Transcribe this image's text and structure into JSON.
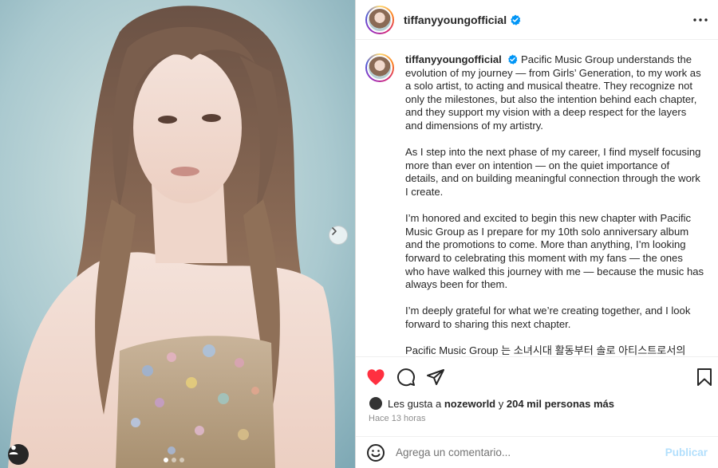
{
  "post": {
    "username": "tiffanyyoungofficial",
    "verified_icon": "verified-badge-icon",
    "accent_color": "#0095f6",
    "caption": {
      "paragraphs": [
        "Pacific Music Group understands the evolution of my journey — from Girls’ Generation, to my work as a solo artist, to acting and musical theatre. They recognize not only the milestones, but also the intention behind each chapter, and they support my vision with a deep respect for the layers and dimensions of my artistry.",
        "As I step into the next phase of my career, I find myself focusing more than ever on intention — on the quiet importance of details, and on building meaningful connection through the work I create.",
        "I’m honored and excited to begin this new chapter with Pacific Music Group as I prepare for my 10th solo anniversary album and the promotions to come. More than anything, I’m looking forward to celebrating this moment with my fans — the ones who have walked this journey with me — because the music has always been for them.",
        "I’m deeply grateful for what we’re creating together, and I look forward to sharing this next chapter.",
        "Pacific Music Group 는 소녀시대 활동부터 솔로 아티스트로서의"
      ]
    },
    "likes": {
      "prefix": "Les gusta a",
      "first_liker": "nozeworld",
      "connector": "y",
      "others": "204 mil personas más"
    },
    "time_ago": "Hace 13 horas",
    "comment": {
      "placeholder": "Agrega un comentario...",
      "publish_label": "Publicar"
    },
    "like_color": "#ff3040"
  }
}
